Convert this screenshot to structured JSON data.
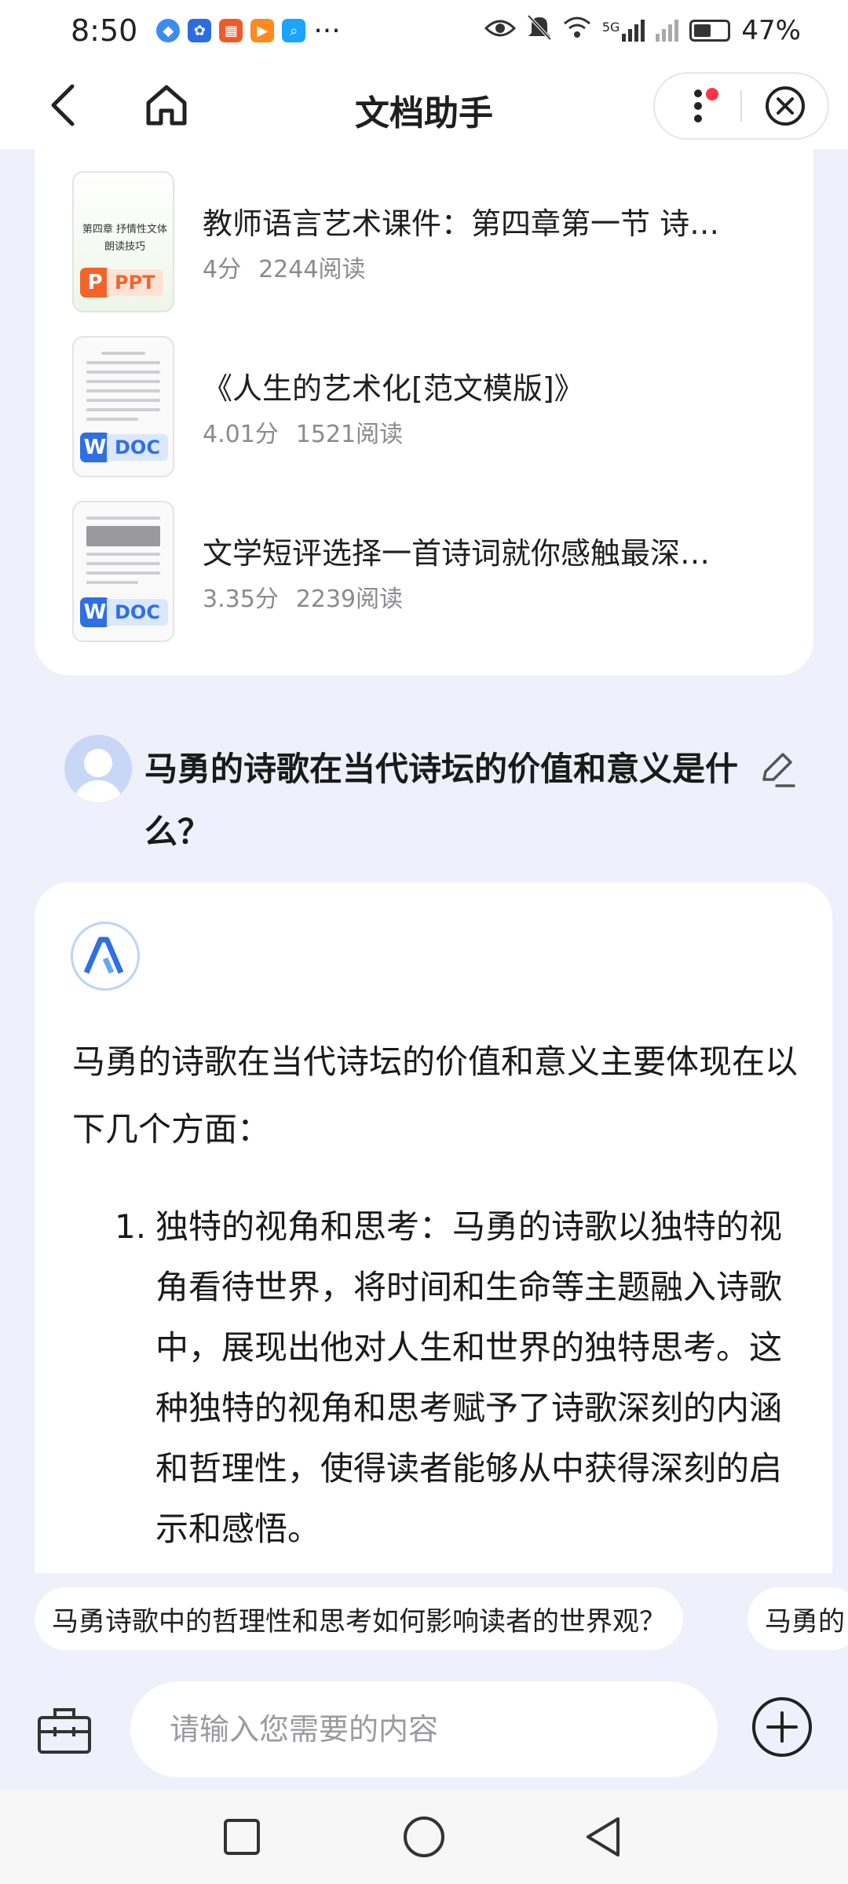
{
  "status_bar": {
    "time": "8:50",
    "more": "···",
    "network": "5G",
    "battery": "47%",
    "battery_level": 0.47
  },
  "header": {
    "title": "文档助手"
  },
  "docs": [
    {
      "title": "教师语言艺术课件：第四章第一节 诗…",
      "score": "4分",
      "reads": "2244阅读",
      "type": "PPT",
      "type_letter": "P",
      "thumb_text": "第四章 抒情性文体\n朗读技巧"
    },
    {
      "title": "《人生的艺术化[范文模版]》",
      "score": "4.01分",
      "reads": "1521阅读",
      "type": "DOC",
      "type_letter": "W"
    },
    {
      "title": "文学短评选择一首诗词就你感触最深…",
      "score": "3.35分",
      "reads": "2239阅读",
      "type": "DOC",
      "type_letter": "W"
    }
  ],
  "question": {
    "text": "马勇的诗歌在当代诗坛的价值和意义是什么？"
  },
  "answer": {
    "intro": "马勇的诗歌在当代诗坛的价值和意义主要体现在以下几个方面：",
    "items": [
      {
        "num": "1.",
        "text": "独特的视角和思考：马勇的诗歌以独特的视角看待世界，将时间和生命等主题融入诗歌中，展现出他对人生和世界的独特思考。这种独特的视角和思考赋予了诗歌深刻的内涵和哲理性，使得读者能够从中获得深刻的启示和感悟。"
      }
    ]
  },
  "suggestions": [
    "马勇诗歌中的哲理性和思考如何影响读者的世界观？",
    "马勇的"
  ],
  "input": {
    "placeholder": "请输入您需要的内容",
    "value": ""
  },
  "colors": {
    "accent": "#2f6fe4",
    "ppt": "#f3642b",
    "doc": "#2f6fe4",
    "background": "#eef1fb"
  }
}
